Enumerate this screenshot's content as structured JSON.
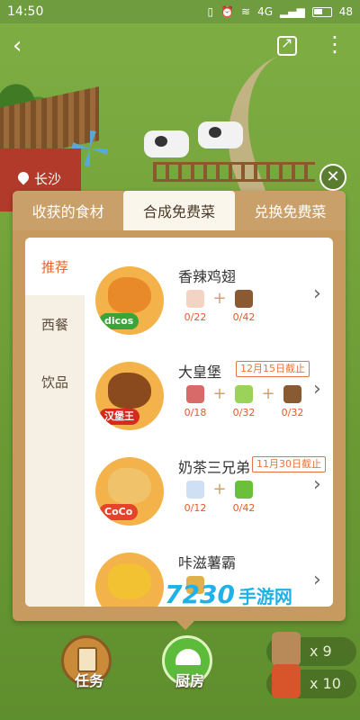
{
  "status_bar": {
    "time": "14:50",
    "battery": "48",
    "network": "4G"
  },
  "location": {
    "city": "长沙"
  },
  "tabs": [
    {
      "label": "收获的食材",
      "active": false
    },
    {
      "label": "合成免费菜",
      "active": true
    },
    {
      "label": "兑换免费菜",
      "active": false
    }
  ],
  "categories": [
    {
      "label": "推荐",
      "active": true
    },
    {
      "label": "西餐",
      "active": false
    },
    {
      "label": "饮品",
      "active": false
    }
  ],
  "dishes": [
    {
      "name": "香辣鸡翅",
      "brand": "dicos",
      "brand_color": "#3aa33a",
      "food_color": "#e8892a",
      "badge": "",
      "ingredients": [
        {
          "icon": "chicken-wing-icon",
          "count": "0/22"
        },
        {
          "icon": "seasoning-bag-icon",
          "count": "0/42"
        }
      ]
    },
    {
      "name": "大皇堡",
      "brand": "汉堡王",
      "brand_color": "#d62a1f",
      "food_color": "#8a4a1e",
      "badge": "12月15日截止",
      "ingredients": [
        {
          "icon": "beef-icon",
          "count": "0/18"
        },
        {
          "icon": "lettuce-icon",
          "count": "0/32"
        },
        {
          "icon": "seasoning-bag-icon",
          "count": "0/32"
        }
      ]
    },
    {
      "name": "奶茶三兄弟",
      "brand": "CoCo",
      "brand_color": "#e2452a",
      "food_color": "#f0c26a",
      "badge": "11月30日截止",
      "ingredients": [
        {
          "icon": "milk-bottle-icon",
          "count": "0/12"
        },
        {
          "icon": "tea-leaf-icon",
          "count": "0/42"
        }
      ]
    },
    {
      "name": "咔滋薯霸",
      "brand": "",
      "brand_color": "#e2452a",
      "food_color": "#f2c232",
      "badge": "",
      "ingredients": [
        {
          "icon": "potato-icon",
          "count": ""
        }
      ]
    }
  ],
  "watermark": {
    "main": "7230",
    "sub": "手游网"
  },
  "bottom_nav": [
    {
      "label": "任务",
      "icon": "clipboard-icon"
    },
    {
      "label": "厨房",
      "icon": "cloche-icon"
    }
  ],
  "inventory": [
    {
      "icon": "seasoning-bag-icon",
      "qty": "x 9"
    },
    {
      "icon": "watering-can-icon",
      "qty": "x 10"
    }
  ]
}
